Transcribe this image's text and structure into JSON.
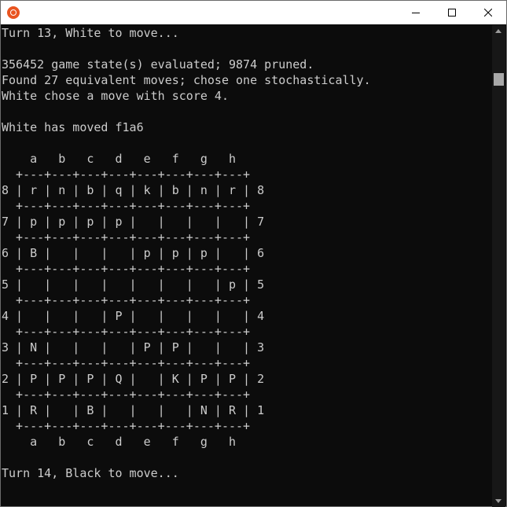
{
  "window": {
    "app_icon": "ubuntu-icon",
    "controls": {
      "minimize": "minimize-icon",
      "maximize": "maximize-icon",
      "close": "close-icon"
    },
    "accent": "#e95420",
    "background": "#0c0c0c",
    "text_color": "#cccccc"
  },
  "console": {
    "lines": [
      "Turn 13, White to move...",
      "",
      "356452 game state(s) evaluated; 9874 pruned.",
      "Found 27 equivalent moves; chose one stochastically.",
      "White chose a move with score 4.",
      "",
      "White has moved f1a6",
      "",
      "    a   b   c   d   e   f   g   h",
      "  +---+---+---+---+---+---+---+---+",
      "8 | r | n | b | q | k | b | n | r | 8",
      "  +---+---+---+---+---+---+---+---+",
      "7 | p | p | p | p |   |   |   |   | 7",
      "  +---+---+---+---+---+---+---+---+",
      "6 | B |   |   |   | p | p | p |   | 6",
      "  +---+---+---+---+---+---+---+---+",
      "5 |   |   |   |   |   |   |   | p | 5",
      "  +---+---+---+---+---+---+---+---+",
      "4 |   |   |   | P |   |   |   |   | 4",
      "  +---+---+---+---+---+---+---+---+",
      "3 | N |   |   |   | P | P |   |   | 3",
      "  +---+---+---+---+---+---+---+---+",
      "2 | P | P | P | Q |   | K | P | P | 2",
      "  +---+---+---+---+---+---+---+---+",
      "1 | R |   | B |   |   |   | N | R | 1",
      "  +---+---+---+---+---+---+---+---+",
      "    a   b   c   d   e   f   g   h",
      "",
      "Turn 14, Black to move..."
    ]
  }
}
